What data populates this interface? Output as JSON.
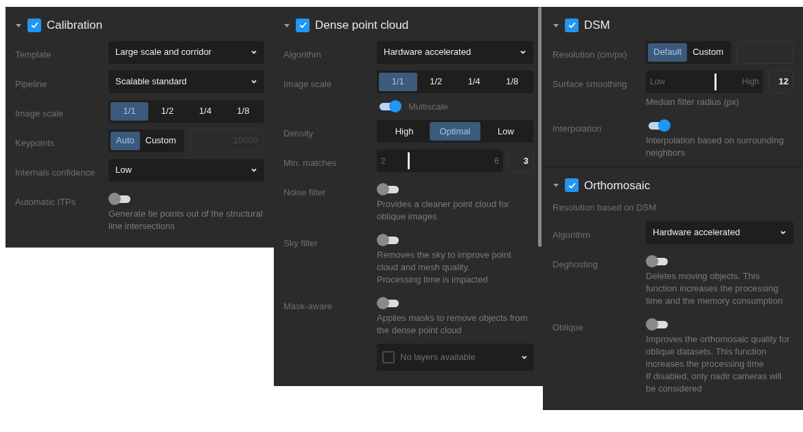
{
  "panels": [
    {
      "scrollbar": false,
      "sections": [
        {
          "title": "Calibration",
          "expanded": true,
          "checked": true,
          "rows": [
            {
              "kind": "select",
              "label": "Template",
              "value": "Large scale and corridor"
            },
            {
              "kind": "select",
              "label": "Pipeline",
              "value": "Scalable standard"
            },
            {
              "kind": "segmented",
              "label": "Image scale",
              "options": [
                {
                  "label": "1/1",
                  "selected": true
                },
                {
                  "label": "1/2",
                  "selected": false
                },
                {
                  "label": "1/4",
                  "selected": false
                },
                {
                  "label": "1/8",
                  "selected": false
                }
              ]
            },
            {
              "kind": "segmented",
              "label": "Keypoints",
              "options": [
                {
                  "label": "Auto",
                  "selected": true
                },
                {
                  "label": "Custom",
                  "selected": false
                }
              ],
              "field": "10000"
            },
            {
              "kind": "select",
              "label": "Internals confidence",
              "value": "Low"
            },
            {
              "kind": "toggle",
              "label": "Automatic ITPs",
              "on": false,
              "description": "Generate tie points out of the structural line intersections"
            }
          ]
        }
      ]
    },
    {
      "scrollbar": true,
      "sections": [
        {
          "title": "Dense point cloud",
          "expanded": true,
          "checked": true,
          "rows": [
            {
              "kind": "select",
              "label": "Algorithm",
              "value": "Hardware accelerated"
            },
            {
              "kind": "segmented",
              "label": "Image scale",
              "options": [
                {
                  "label": "1/1",
                  "selected": true
                },
                {
                  "label": "1/2",
                  "selected": false
                },
                {
                  "label": "1/4",
                  "selected": false
                },
                {
                  "label": "1/8",
                  "selected": false
                }
              ]
            },
            {
              "kind": "inline_toggle",
              "text": "Multiscale",
              "on": true
            },
            {
              "kind": "segmented",
              "label": "Density",
              "options": [
                {
                  "label": "High",
                  "selected": false
                },
                {
                  "label": "Optimal",
                  "selected": true
                },
                {
                  "label": "Low",
                  "selected": false
                }
              ]
            },
            {
              "kind": "slider",
              "label": "Min. matches",
              "min": "2",
              "max": "6",
              "level": 0.25,
              "value": "3"
            },
            {
              "kind": "toggle",
              "label": "Noise filter",
              "on": false,
              "description": "Provides a cleaner point cloud for oblique images"
            },
            {
              "kind": "toggle",
              "label": "Sky filter",
              "on": false,
              "description": "Removes the sky to improve point cloud and mesh quality.\nProcessing time is impacted"
            },
            {
              "kind": "toggle",
              "label": "Mask-aware",
              "on": false,
              "description": "Applies masks to remove objects from the dense point cloud"
            },
            {
              "kind": "layer_select",
              "checked": false,
              "value": "No layers available"
            }
          ]
        }
      ]
    },
    {
      "scrollbar": false,
      "sections": [
        {
          "title": "DSM",
          "expanded": true,
          "checked": true,
          "rows": [
            {
              "kind": "segmented",
              "label": "Resolution (cm/px)",
              "options": [
                {
                  "label": "Default",
                  "selected": true
                },
                {
                  "label": "Custom",
                  "selected": false
                }
              ],
              "field": "-"
            },
            {
              "kind": "slider",
              "label": "Surface smoothing",
              "min": "Low",
              "max": "High",
              "level": 0.59,
              "value": "12",
              "description": "Median filter radius (px)"
            },
            {
              "kind": "toggle",
              "label": "Interpolation",
              "on": true,
              "description": "Interpolation based on surrounding neighbors"
            }
          ]
        },
        {
          "title": "Orthomosaic",
          "expanded": true,
          "checked": true,
          "rows": [
            {
              "kind": "note",
              "text": "Resolution based on DSM"
            },
            {
              "kind": "select",
              "label": "Algorithm",
              "value": "Hardware accelerated"
            },
            {
              "kind": "toggle",
              "label": "Deghosting",
              "on": false,
              "description": "Deletes moving objects. This function increases the processing time and the memory consumption"
            },
            {
              "kind": "toggle",
              "label": "Oblique",
              "on": false,
              "description": "Improves the orthomosaic quality for oblique datasets. This function increases the processing time\nIf disabled, only nadir cameras will be considered"
            }
          ]
        }
      ]
    }
  ]
}
